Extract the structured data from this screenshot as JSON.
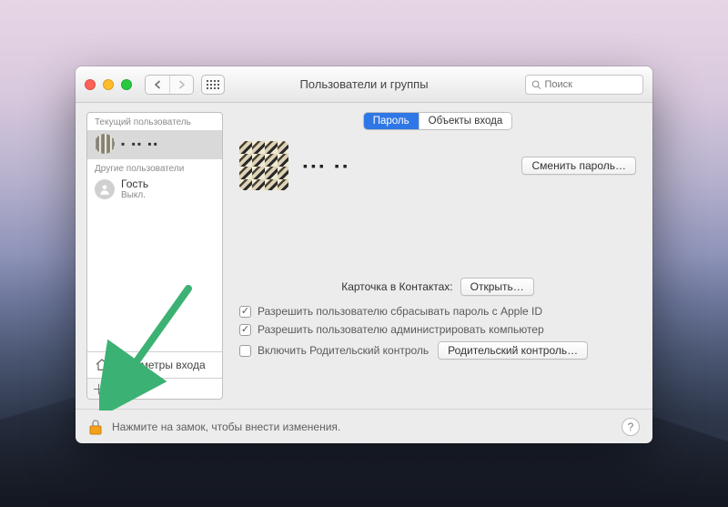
{
  "window": {
    "title": "Пользователи и группы"
  },
  "toolbar": {
    "search_placeholder": "Поиск"
  },
  "sidebar": {
    "current_header": "Текущий пользователь",
    "others_header": "Другие пользователи",
    "current_user": {
      "name_redacted": "▪ ▪▪ ▪▪"
    },
    "guest": {
      "name": "Гость",
      "status": "Выкл."
    },
    "login_options": "Параметры входа"
  },
  "tabs": {
    "password": "Пароль",
    "login_items": "Объекты входа"
  },
  "main": {
    "username_redacted": "▪▪▪ ▪▪",
    "change_password": "Сменить пароль…",
    "contacts_label": "Карточка в Контактах:",
    "contacts_open": "Открыть…",
    "allow_reset": "Разрешить пользователю сбрасывать пароль с Apple ID",
    "allow_admin": "Разрешить пользователю администрировать компьютер",
    "parental_enable": "Включить Родительский контроль",
    "parental_open": "Родительский контроль…"
  },
  "footer": {
    "lock_hint": "Нажмите на замок, чтобы внести изменения."
  }
}
